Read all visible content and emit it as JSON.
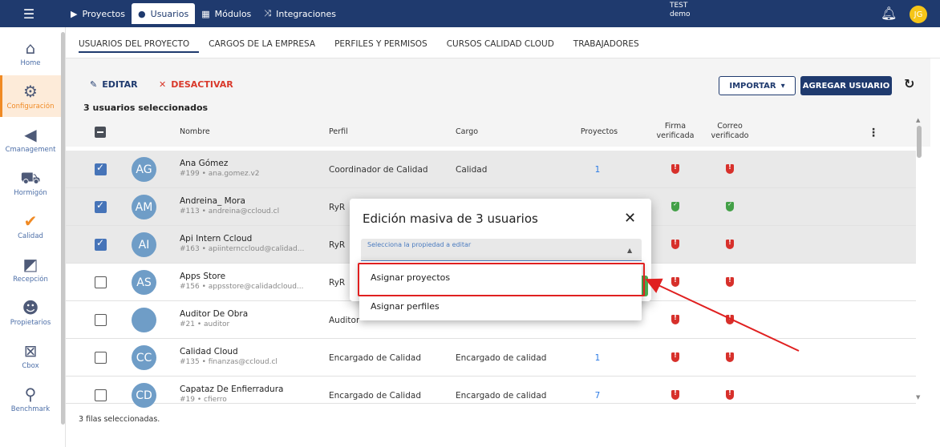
{
  "topbar": {
    "nav": [
      {
        "label": "Proyectos",
        "icon": "folder-icon"
      },
      {
        "label": "Usuarios",
        "icon": "user-icon"
      },
      {
        "label": "Módulos",
        "icon": "grid-icon"
      },
      {
        "label": "Integraciones",
        "icon": "shuffle-icon"
      }
    ],
    "project_line1": "TEST",
    "project_line2": "demo",
    "avatar_initials": "JG"
  },
  "sidebar": {
    "items": [
      {
        "label": "Home"
      },
      {
        "label": "Configuración"
      },
      {
        "label": "Cmanagement"
      },
      {
        "label": "Hormigón"
      },
      {
        "label": "Calidad"
      },
      {
        "label": "Recepción"
      },
      {
        "label": "Propietarios"
      },
      {
        "label": "Cbox"
      },
      {
        "label": "Benchmark"
      }
    ]
  },
  "tabs": [
    "USUARIOS DEL PROYECTO",
    "CARGOS DE LA EMPRESA",
    "PERFILES Y PERMISOS",
    "CURSOS CALIDAD CLOUD",
    "TRABAJADORES"
  ],
  "toolbar": {
    "edit_label": "EDITAR",
    "deactivate_label": "DESACTIVAR",
    "selected_count": "3 usuarios seleccionados",
    "import_label": "IMPORTAR",
    "add_label": "AGREGAR USUARIO"
  },
  "table": {
    "headers": {
      "name": "Nombre",
      "profile": "Perfil",
      "role": "Cargo",
      "projects": "Proyectos",
      "signature_l1": "Firma",
      "signature_l2": "verificada",
      "email_l1": "Correo",
      "email_l2": "verificado"
    },
    "rows": [
      {
        "initials": "AG",
        "name": "Ana Gómez",
        "sub": "#199 • ana.gomez.v2",
        "profile": "Coordinador de Calidad",
        "role": "Calidad",
        "projects": "1",
        "selected": true
      },
      {
        "initials": "AM",
        "name": "Andreina_ Mora",
        "sub": "#113 • andreina@ccloud.cl",
        "profile": "RyR",
        "role": "",
        "projects": "",
        "selected": true
      },
      {
        "initials": "AI",
        "name": "Api Intern Ccloud",
        "sub": "#163 • apiinternccloud@calidad...",
        "profile": "RyR",
        "role": "",
        "projects": "",
        "selected": true
      },
      {
        "initials": "AS",
        "name": "Apps Store",
        "sub": "#156 • appsstore@calidadcloud...",
        "profile": "RyR",
        "role": "",
        "projects": "",
        "selected": false
      },
      {
        "initials": "",
        "name": "Auditor De Obra",
        "sub": "#21 • auditor",
        "profile": "Auditor",
        "role": "",
        "projects": "",
        "selected": false
      },
      {
        "initials": "CC",
        "name": "Calidad Cloud",
        "sub": "#135 • finanzas@ccloud.cl",
        "profile": "Encargado de Calidad",
        "role": "Encargado de calidad",
        "projects": "1",
        "selected": false
      },
      {
        "initials": "CD",
        "name": "Capataz De Enfierradura",
        "sub": "#19 • cfierro",
        "profile": "Encargado de Calidad",
        "role": "Encargado de calidad",
        "projects": "7",
        "selected": false
      }
    ],
    "footer": "3 filas seleccionadas."
  },
  "modal": {
    "title": "Edición masiva de 3 usuarios",
    "select_label": "Selecciona la propiedad a editar",
    "options": [
      "Asignar proyectos",
      "Asignar perfiles"
    ]
  },
  "colors": {
    "primary": "#1f3a6e",
    "accent": "#f08a24",
    "danger": "#d9392b",
    "highlight": "#e02020"
  }
}
